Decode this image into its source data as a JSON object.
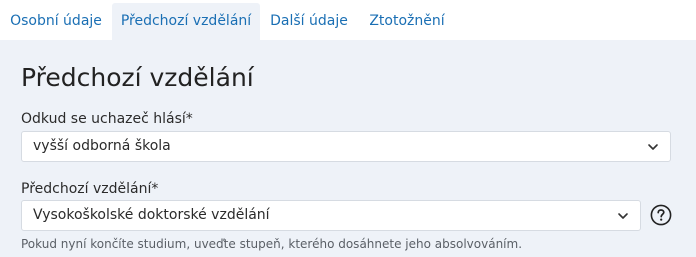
{
  "tabs": [
    {
      "label": "Osobní údaje",
      "active": false
    },
    {
      "label": "Předchozí vzdělání",
      "active": true
    },
    {
      "label": "Další údaje",
      "active": false
    },
    {
      "label": "Ztotožnění",
      "active": false
    }
  ],
  "section": {
    "title": "Předchozí vzdělání",
    "source_field": {
      "label": "Odkud se uchazeč hlásí*",
      "value": "vyšší odborná škola"
    },
    "education_field": {
      "label": "Předchozí vzdělání*",
      "value": "Vysokoškolské doktorské vzdělání",
      "hint": "Pokud nyní končíte studium, uveďte stupeň, kterého dosáhnete jeho absolvováním."
    }
  },
  "icons": {
    "chevron": "chevron-down-icon",
    "help": "question-circle-icon"
  },
  "colors": {
    "accent": "#1a6fb4",
    "panel_bg": "#eef2f8"
  }
}
